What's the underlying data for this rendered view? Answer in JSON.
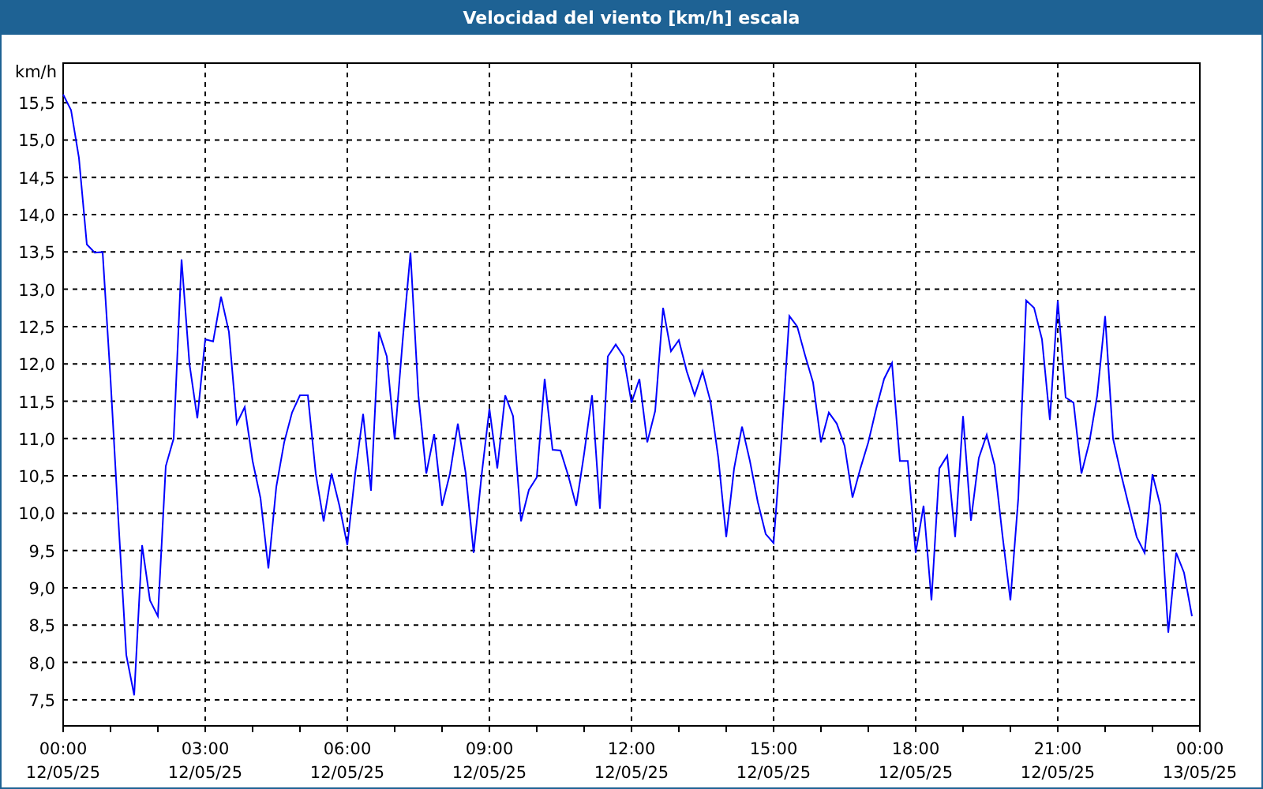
{
  "window": {
    "title": "Velocidad del viento [km/h] escala"
  },
  "chart": {
    "chart_data": {
      "type": "line",
      "grid": true,
      "ylabel": "km/h",
      "ylim": [
        7.15,
        16.03
      ],
      "categories": [
        "00:00 12/05/25",
        null,
        null,
        null,
        null,
        null,
        null,
        null,
        null,
        null,
        null,
        null,
        null,
        null,
        null,
        null,
        null,
        null,
        "03:00 12/05/25",
        null,
        null,
        null,
        null,
        null,
        null,
        null,
        null,
        null,
        null,
        null,
        null,
        null,
        null,
        null,
        null,
        null,
        "06:00 12/05/25",
        null,
        null,
        null,
        null,
        null,
        null,
        null,
        null,
        null,
        null,
        null,
        null,
        null,
        null,
        null,
        null,
        null,
        "09:00 12/05/25",
        null,
        null,
        null,
        null,
        null,
        null,
        null,
        null,
        null,
        null,
        null,
        null,
        null,
        null,
        null,
        null,
        null,
        "12:00 12/05/25",
        null,
        null,
        null,
        null,
        null,
        null,
        null,
        null,
        null,
        null,
        null,
        null,
        null,
        null,
        null,
        null,
        null,
        "15:00 12/05/25",
        null,
        null,
        null,
        null,
        null,
        null,
        null,
        null,
        null,
        null,
        null,
        null,
        null,
        null,
        null,
        null,
        null,
        "18:00 12/05/25",
        null,
        null,
        null,
        null,
        null,
        null,
        null,
        null,
        null,
        null,
        null,
        null,
        null,
        null,
        null,
        null,
        null,
        "21:00 12/05/25",
        null,
        null,
        null,
        null,
        null,
        null,
        null,
        null,
        null,
        null,
        null,
        null,
        null,
        null,
        null,
        null,
        null,
        "00:00 13/05/25"
      ],
      "yticks": [
        {
          "value": 7.5,
          "label": "7,5"
        },
        {
          "value": 8,
          "label": "8,0"
        },
        {
          "value": 8.5,
          "label": "8,5"
        },
        {
          "value": 9,
          "label": "9,0"
        },
        {
          "value": 9.5,
          "label": "9,5"
        },
        {
          "value": 10,
          "label": "10,0"
        },
        {
          "value": 10.5,
          "label": "10,5"
        },
        {
          "value": 11,
          "label": "11,0"
        },
        {
          "value": 11.5,
          "label": "11,5"
        },
        {
          "value": 12,
          "label": "12,0"
        },
        {
          "value": 12.5,
          "label": "12,5"
        },
        {
          "value": 13,
          "label": "13,0"
        },
        {
          "value": 13.5,
          "label": "13,5"
        },
        {
          "value": 14,
          "label": "14,0"
        },
        {
          "value": 14.5,
          "label": "14,5"
        },
        {
          "value": 15,
          "label": "15,0"
        },
        {
          "value": 15.5,
          "label": "15,5"
        }
      ],
      "series": [
        {
          "color": "#0000ff",
          "values": [
            15.61,
            15.4,
            14.76,
            13.6,
            13.49,
            13.5,
            11.8,
            9.9,
            8.1,
            7.56,
            9.57,
            8.83,
            8.62,
            10.63,
            11.0,
            13.4,
            12.0,
            11.27,
            12.33,
            12.3,
            12.9,
            12.43,
            11.2,
            11.42,
            10.7,
            10.2,
            9.26,
            10.35,
            10.95,
            11.35,
            11.58,
            11.58,
            10.53,
            9.89,
            10.53,
            10.1,
            9.57,
            10.53,
            11.33,
            10.3,
            12.43,
            12.1,
            10.99,
            12.3,
            13.49,
            11.58,
            10.53,
            11.06,
            10.1,
            10.53,
            11.2,
            10.53,
            9.47,
            10.5,
            11.4,
            10.6,
            11.58,
            11.3,
            9.89,
            10.31,
            10.48,
            11.8,
            10.85,
            10.84,
            10.5,
            10.1,
            10.8,
            11.58,
            10.06,
            12.1,
            12.26,
            12.1,
            11.48,
            11.8,
            10.95,
            11.37,
            12.75,
            12.17,
            12.32,
            11.9,
            11.58,
            11.9,
            11.5,
            10.74,
            9.68,
            10.6,
            11.16,
            10.7,
            10.15,
            9.72,
            9.6,
            11.0,
            12.64,
            12.5,
            12.11,
            11.75,
            10.95,
            11.35,
            11.2,
            10.9,
            10.21,
            10.6,
            10.95,
            11.4,
            11.8,
            12.01,
            10.7,
            10.7,
            9.47,
            10.1,
            8.83,
            10.6,
            10.77,
            9.68,
            11.3,
            9.9,
            10.74,
            11.05,
            10.64,
            9.7,
            8.83,
            10.2,
            12.85,
            12.75,
            12.33,
            11.25,
            12.85,
            11.55,
            11.48,
            10.53,
            10.95,
            11.58,
            12.64,
            11.0,
            10.53,
            10.1,
            9.68,
            9.47,
            10.52,
            10.1,
            8.4,
            9.47,
            9.2,
            8.62,
            null
          ]
        }
      ]
    }
  }
}
